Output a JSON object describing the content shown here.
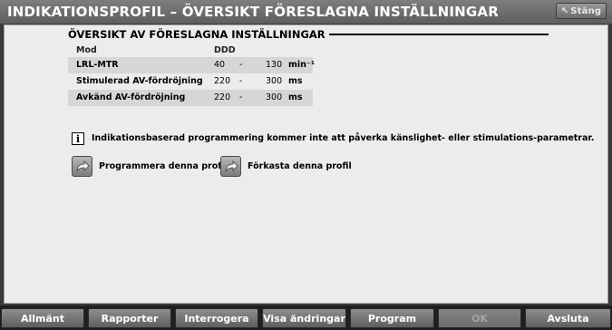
{
  "window": {
    "title": "INDIKATIONSPROFIL – ÖVERSIKT FÖRESLAGNA INSTÄLLNINGAR",
    "close_label": "Stäng",
    "close_icon": "arrow-up-left-icon"
  },
  "overview": {
    "section_title": "ÖVERSIKT AV FÖRESLAGNA INSTÄLLNINGAR",
    "headers": {
      "mode": "Mod",
      "ddd": "DDD"
    },
    "rows": [
      {
        "label": "LRL-MTR",
        "low": "40",
        "dash": "-",
        "high": "130",
        "unit": "min⁻¹"
      },
      {
        "label": "Stimulerad AV-fördröjning",
        "low": "220",
        "dash": "-",
        "high": "300",
        "unit": "ms"
      },
      {
        "label": "Avkänd AV-fördröjning",
        "low": "220",
        "dash": "-",
        "high": "300",
        "unit": "ms"
      }
    ]
  },
  "info": {
    "icon": "info-icon",
    "text": "Indikationsbaserad programmering kommer inte att påverka känslighet- eller stimulations-parametrar."
  },
  "actions": {
    "program_profile": "Programmera denna profil",
    "discard_profile": "Förkasta denna profil"
  },
  "bottom_bar": [
    {
      "label": "Allmänt",
      "enabled": true
    },
    {
      "label": "Rapporter",
      "enabled": true
    },
    {
      "label": "Interrogera",
      "enabled": true
    },
    {
      "label": "Visa ändringar",
      "enabled": true
    },
    {
      "label": "Program",
      "enabled": true
    },
    {
      "label": "OK",
      "enabled": false
    },
    {
      "label": "Avsluta",
      "enabled": true
    }
  ]
}
